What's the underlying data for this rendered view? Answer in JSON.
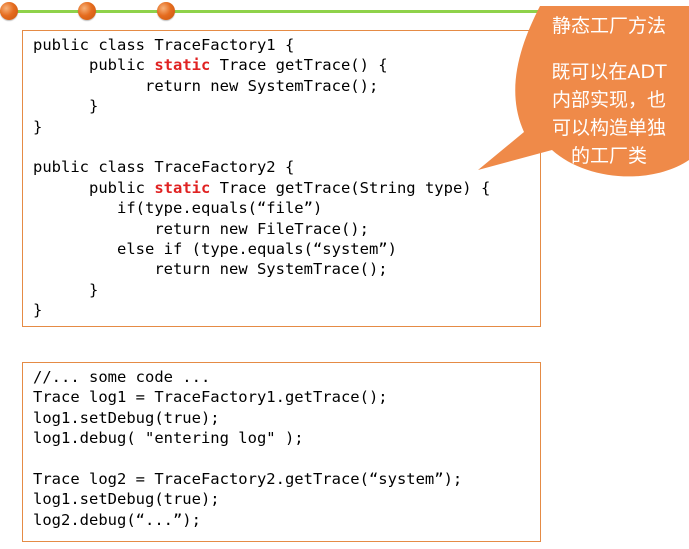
{
  "slide": {
    "decoration_colors": {
      "line": "#8fd24a",
      "dot": "#e56c1f",
      "box_border": "#e58b45",
      "callout_fill": "#ef8a49",
      "keyword": "#e02222"
    }
  },
  "code_block_1": {
    "lines": [
      {
        "indent": "",
        "pre": "public class TraceFactory1 {",
        "kw": "",
        "post": ""
      },
      {
        "indent": "      ",
        "pre": "public ",
        "kw": "static",
        "post": " Trace getTrace() {"
      },
      {
        "indent": "            ",
        "pre": "return new SystemTrace();",
        "kw": "",
        "post": ""
      },
      {
        "indent": "      ",
        "pre": "}",
        "kw": "",
        "post": ""
      },
      {
        "indent": "",
        "pre": "}",
        "kw": "",
        "post": ""
      },
      {
        "indent": "",
        "pre": "",
        "kw": "",
        "post": ""
      },
      {
        "indent": "",
        "pre": "public class TraceFactory2 {",
        "kw": "",
        "post": ""
      },
      {
        "indent": "      ",
        "pre": "public ",
        "kw": "static",
        "post": " Trace getTrace(String type) {"
      },
      {
        "indent": "         ",
        "pre": "if(type.equals(“file”)",
        "kw": "",
        "post": ""
      },
      {
        "indent": "             ",
        "pre": "return new FileTrace();",
        "kw": "",
        "post": ""
      },
      {
        "indent": "         ",
        "pre": "else if (type.equals(“system”)",
        "kw": "",
        "post": ""
      },
      {
        "indent": "             ",
        "pre": "return new SystemTrace();",
        "kw": "",
        "post": ""
      },
      {
        "indent": "      ",
        "pre": "}",
        "kw": "",
        "post": ""
      },
      {
        "indent": "",
        "pre": "}",
        "kw": "",
        "post": ""
      }
    ]
  },
  "code_block_2": {
    "lines": [
      "//... some code ...",
      "Trace log1 = TraceFactory1.getTrace();",
      "log1.setDebug(true);",
      "log1.debug( \"entering log\" );",
      "",
      "Trace log2 = TraceFactory2.getTrace(“system”);",
      "log1.setDebug(true);",
      "log2.debug(“...”);"
    ]
  },
  "callout": {
    "title": "静态工厂方法",
    "body_lines": [
      "既可以在ADT",
      "内部实现，也",
      "可以构造单独",
      "的工厂类"
    ]
  }
}
